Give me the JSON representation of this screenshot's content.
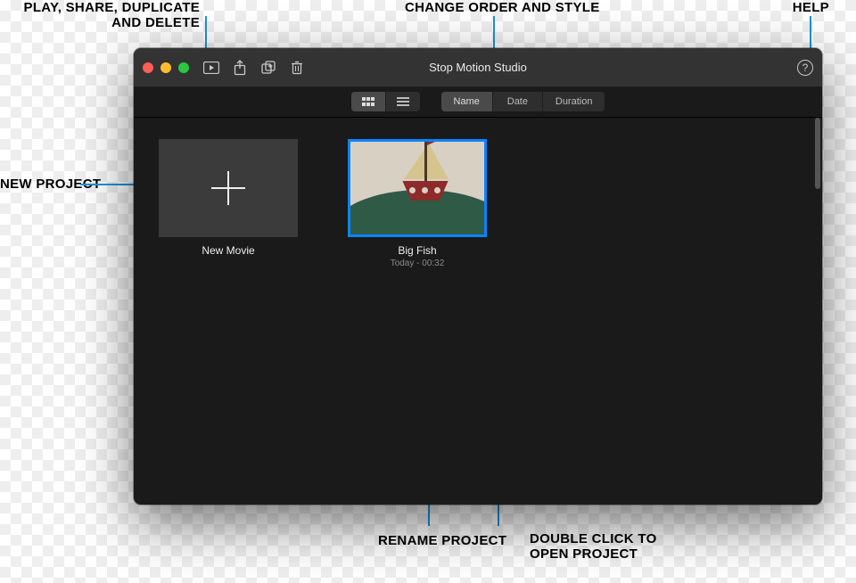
{
  "annotations": {
    "play_share": "PLAY, SHARE, DUPLICATE\nAND DELETE",
    "change_order": "CHANGE ORDER AND STYLE",
    "help": "HELP",
    "new_project": "NEW PROJECT",
    "rename": "RENAME PROJECT",
    "double_click": "DOUBLE CLICK TO\nOPEN PROJECT"
  },
  "window": {
    "title": "Stop Motion Studio"
  },
  "toolbar": {
    "play_icon": "play",
    "share_icon": "share",
    "duplicate_icon": "duplicate",
    "delete_icon": "trash",
    "help_glyph": "?"
  },
  "subbar": {
    "view_grid": "grid",
    "view_list": "list",
    "sort": {
      "name": "Name",
      "date": "Date",
      "duration": "Duration"
    }
  },
  "projects": {
    "new_movie": {
      "title": "New Movie"
    },
    "big_fish": {
      "title": "Big Fish",
      "subtitle": "Today - 00:32"
    }
  }
}
